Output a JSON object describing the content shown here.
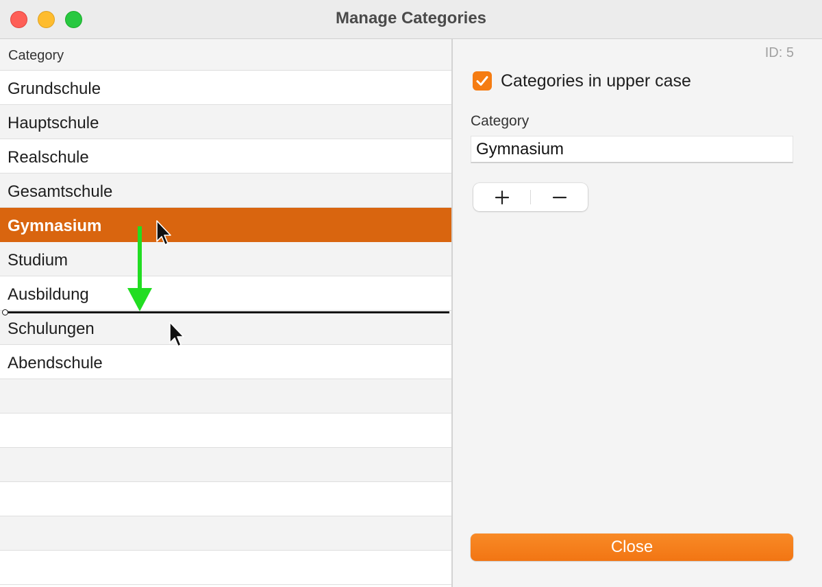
{
  "window": {
    "title": "Manage Categories"
  },
  "table": {
    "column_header": "Category",
    "rows": [
      {
        "label": "Grundschule"
      },
      {
        "label": "Hauptschule"
      },
      {
        "label": "Realschule"
      },
      {
        "label": "Gesamtschule"
      },
      {
        "label": "Gymnasium",
        "selected": true
      },
      {
        "label": "Studium"
      },
      {
        "label": "Ausbildung"
      },
      {
        "label": "Schulungen"
      },
      {
        "label": "Abendschule"
      },
      {
        "label": ""
      },
      {
        "label": ""
      },
      {
        "label": ""
      },
      {
        "label": ""
      },
      {
        "label": ""
      },
      {
        "label": ""
      }
    ],
    "drop_indicator_after": "Ausbildung"
  },
  "detail": {
    "id_label": "ID: 5",
    "uppercase_checkbox": {
      "label": "Categories in upper case",
      "checked": true
    },
    "category_field": {
      "label": "Category",
      "value": "Gymnasium"
    },
    "add_icon": "plus-icon",
    "remove_icon": "minus-icon",
    "close_label": "Close"
  },
  "colors": {
    "accent": "#f57c12",
    "selection": "#d9650f",
    "drag_arrow": "#22dd22"
  }
}
